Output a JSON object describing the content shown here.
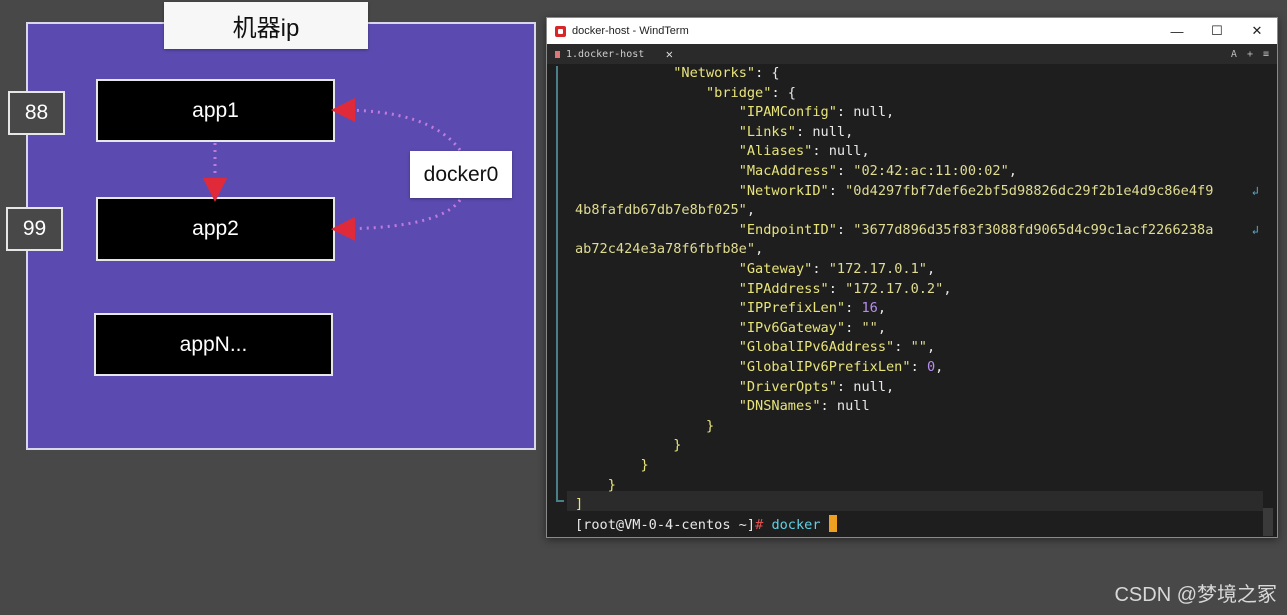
{
  "diagram": {
    "machine_label": "机器ip",
    "apps": [
      "app1",
      "app2",
      "appN..."
    ],
    "ports": [
      "88",
      "99"
    ],
    "bridge_label": "docker0"
  },
  "window": {
    "title": "docker-host - WindTerm",
    "tab_label": "1.docker-host",
    "tab_close": "✕",
    "tools": [
      "A",
      "+",
      "≡"
    ],
    "controls": {
      "minimize": "—",
      "maximize": "☐",
      "close": "✕"
    }
  },
  "terminal": {
    "networks_key": "\"Networks\"",
    "bridge_key": "\"bridge\"",
    "ipam_key": "\"IPAMConfig\"",
    "links_key": "\"Links\"",
    "aliases_key": "\"Aliases\"",
    "mac_key": "\"MacAddress\"",
    "mac_val": "\"02:42:ac:11:00:02\"",
    "netid_key": "\"NetworkID\"",
    "netid_val1": "\"0d4297fbf7def6e2bf5d98826dc29f2b1e4d9c86e4f9",
    "netid_val2": "4b8fafdb67db7e8bf025\"",
    "endpoint_key": "\"EndpointID\"",
    "endpoint_val1": "\"3677d896d35f83f3088fd9065d4c99c1acf2266238a",
    "endpoint_val2": "ab72c424e3a78f6fbfb8e\"",
    "gateway_key": "\"Gateway\"",
    "gateway_val": "\"172.17.0.1\"",
    "ipaddr_key": "\"IPAddress\"",
    "ipaddr_val": "\"172.17.0.2\"",
    "prefix_key": "\"IPPrefixLen\"",
    "prefix_val": "16",
    "ipv6gw_key": "\"IPv6Gateway\"",
    "ipv6gw_val": "\"\"",
    "gipv6_key": "\"GlobalIPv6Address\"",
    "gipv6_val": "\"\"",
    "gipv6len_key": "\"GlobalIPv6PrefixLen\"",
    "gipv6len_val": "0",
    "driver_key": "\"DriverOpts\"",
    "dns_key": "\"DNSNames\"",
    "null_word": "null",
    "wrap_symbol": "↲",
    "prompt_user": "[root@VM-0-4-centos ~]",
    "prompt_hash": "#",
    "command": "docker"
  },
  "watermark": "CSDN @梦境之冢"
}
